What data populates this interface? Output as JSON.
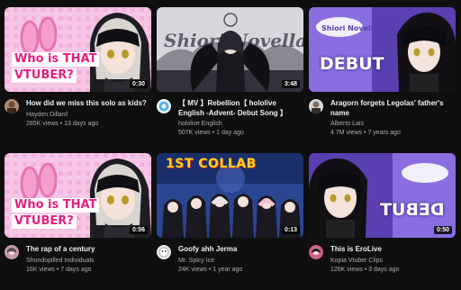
{
  "videos": [
    {
      "title": "How did we miss this solo as kids?",
      "channel": "Hayden Dillard",
      "stats": "285K views • 13 days ago",
      "duration": "0:30",
      "thumb_text_1": "Who is THAT",
      "thumb_text_2": "VTUBER?",
      "avatar_color": "#b08a70"
    },
    {
      "title": "【 MV 】Rebellion【 hololive English -Advent- Debut Song 】",
      "channel": "hololive English",
      "stats": "507K views • 1 day ago",
      "duration": "3:48",
      "avatar_color": "#5ab4e6"
    },
    {
      "title": "Aragorn forgets Legolas' father's name",
      "channel": "Alberto Lais",
      "stats": "4.7M views • 7 years ago",
      "duration": "",
      "thumb_text_1": "DEBUT",
      "avatar_color": "#d8d8d8"
    },
    {
      "title": "The rap of a century",
      "channel": "Shondopilled Individuals",
      "stats": "16K views • 7 days ago",
      "duration": "0:56",
      "thumb_text_1": "Who is THAT",
      "thumb_text_2": "VTUBER?",
      "avatar_color": "#c89aa8"
    },
    {
      "title": "Goofy ahh Jerma",
      "channel": "Mr. Spicy Ice",
      "stats": "24K views • 1 year ago",
      "duration": "0:13",
      "thumb_text_1": "1ST COLLAB",
      "avatar_color": "#e8e8e8"
    },
    {
      "title": "This is EroLive",
      "channel": "Kopia Vtuber Clips",
      "stats": "126K views • 3 days ago",
      "duration": "0:50",
      "thumb_text_1": "DEBUT",
      "avatar_color": "#d06080"
    }
  ],
  "colors": {
    "background": "#0f0f0f",
    "title": "#f1f1f1",
    "secondary": "#aaaaaa",
    "pink_accent": "#e6207e"
  }
}
